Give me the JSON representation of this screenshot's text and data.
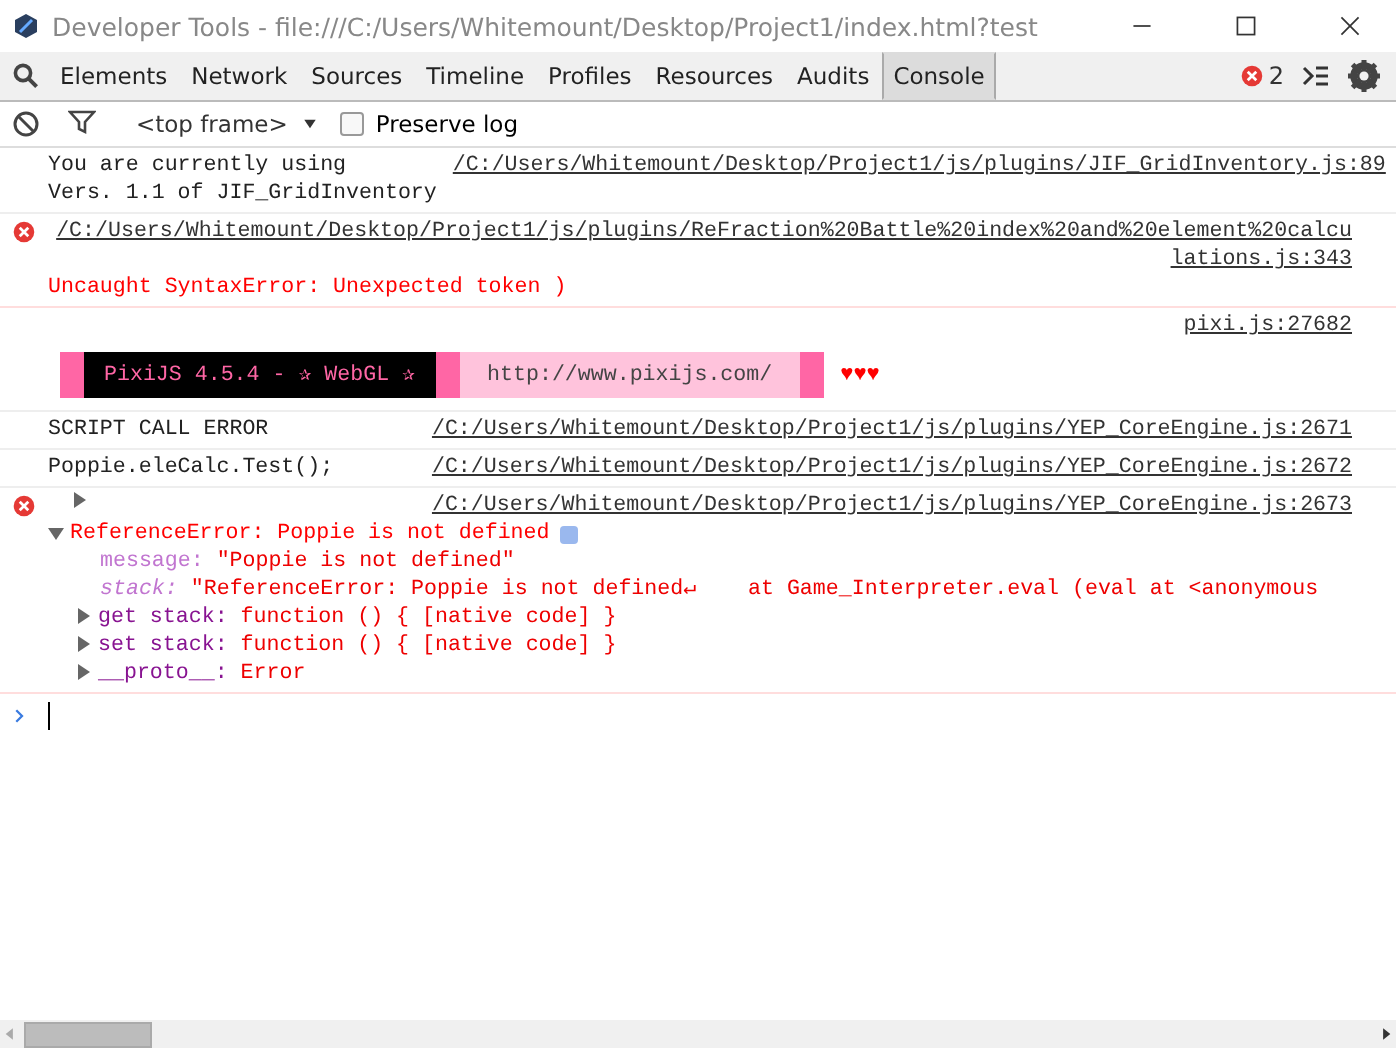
{
  "window": {
    "title": "Developer Tools - file:///C:/Users/Whitemount/Desktop/Project1/index.html?test"
  },
  "tabs": [
    {
      "label": "Elements",
      "selected": false
    },
    {
      "label": "Network",
      "selected": false
    },
    {
      "label": "Sources",
      "selected": false
    },
    {
      "label": "Timeline",
      "selected": false
    },
    {
      "label": "Profiles",
      "selected": false
    },
    {
      "label": "Resources",
      "selected": false
    },
    {
      "label": "Audits",
      "selected": false
    },
    {
      "label": "Console",
      "selected": true
    }
  ],
  "error_count": "2",
  "console_toolbar": {
    "frame": "<top frame>",
    "preserve_log": {
      "label": "Preserve log",
      "checked": false
    }
  },
  "messages": [
    {
      "kind": "log",
      "lines": [
        "You are currently using",
        "Vers. 1.1 of JIF_GridInventory"
      ],
      "source": "/C:/Users/Whitemount/Desktop/Project1/js/plugins/JIF_GridInventory.js:89"
    },
    {
      "kind": "error",
      "source": "/C:/Users/Whitemount/Desktop/Project1/js/plugins/ReFraction%20Battle%20index%20and%20element%20calculations.js:343",
      "text": "Uncaught SyntaxError: Unexpected token )"
    },
    {
      "kind": "banner",
      "source": "pixi.js:27682",
      "banner_text": "PixiJS 4.5.4 - ✰ WebGL ✰",
      "banner_url": "http://www.pixijs.com/",
      "hearts": "♥♥♥"
    },
    {
      "kind": "log",
      "lines": [
        "SCRIPT CALL ERROR"
      ],
      "source": "/C:/Users/Whitemount/Desktop/Project1/js/plugins/YEP_CoreEngine.js:2671"
    },
    {
      "kind": "log",
      "lines": [
        "Poppie.eleCalc.Test();"
      ],
      "source": "/C:/Users/Whitemount/Desktop/Project1/js/plugins/YEP_CoreEngine.js:2672"
    },
    {
      "kind": "error_object",
      "source": "/C:/Users/Whitemount/Desktop/Project1/js/plugins/YEP_CoreEngine.js:2673",
      "trace_expanded": false,
      "object": {
        "label": "ReferenceError: Poppie is not defined",
        "expanded": true,
        "properties": [
          {
            "kind": "own",
            "key": "message:",
            "value": "\"Poppie is not defined\""
          },
          {
            "kind": "own_italic",
            "key": "stack:",
            "value": "\"ReferenceError: Poppie is not defined↵    at Game_Interpreter.eval (eval at <anonymous"
          },
          {
            "kind": "accessor",
            "key": "get stack:",
            "value": "function () { [native code] }",
            "expanded": false
          },
          {
            "kind": "accessor",
            "key": "set stack:",
            "value": "function () { [native code] }",
            "expanded": false
          },
          {
            "kind": "accessor",
            "key": "__proto__:",
            "value": "Error",
            "expanded": false
          }
        ]
      }
    }
  ]
}
